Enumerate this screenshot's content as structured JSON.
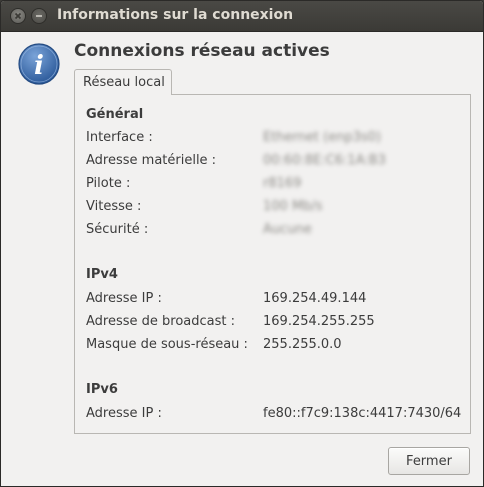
{
  "window": {
    "title": "Informations sur la connexion"
  },
  "heading": "Connexions réseau actives",
  "tabs": [
    {
      "label": "Réseau local"
    }
  ],
  "sections": {
    "general": {
      "title": "Général",
      "rows": [
        {
          "label": "Interface :",
          "value": "Ethernet (enp3s0)"
        },
        {
          "label": "Adresse matérielle :",
          "value": "00:60:8E:C6:1A:B3"
        },
        {
          "label": "Pilote :",
          "value": "r8169"
        },
        {
          "label": "Vitesse :",
          "value": "100 Mb/s"
        },
        {
          "label": "Sécurité :",
          "value": "Aucune"
        }
      ]
    },
    "ipv4": {
      "title": "IPv4",
      "rows": [
        {
          "label": "Adresse IP :",
          "value": "169.254.49.144"
        },
        {
          "label": "Adresse de broadcast :",
          "value": "169.254.255.255"
        },
        {
          "label": "Masque de sous-réseau :",
          "value": "255.255.0.0"
        }
      ]
    },
    "ipv6": {
      "title": "IPv6",
      "rows": [
        {
          "label": "Adresse IP :",
          "value": "fe80::f7c9:138c:4417:7430/64"
        }
      ]
    }
  },
  "buttons": {
    "close_label": "Fermer"
  },
  "icons": {
    "info": "info-icon",
    "window_close": "close-icon",
    "window_minimize": "minimize-icon"
  },
  "colors": {
    "titlebar": "#3c3b37",
    "dialog_bg": "#f2f1f0",
    "info_icon": "#3465a4",
    "text": "#3c3c3c"
  }
}
